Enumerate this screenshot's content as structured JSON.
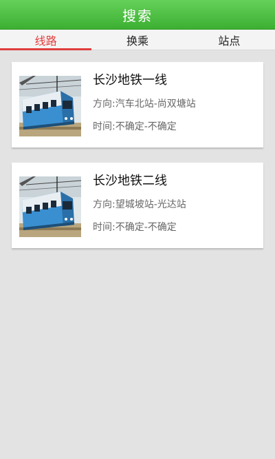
{
  "header": {
    "title": "搜索"
  },
  "tabs": [
    {
      "label": "线路",
      "active": true
    },
    {
      "label": "换乘",
      "active": false
    },
    {
      "label": "站点",
      "active": false
    }
  ],
  "lines": [
    {
      "name": "长沙地铁一线",
      "direction": "方向:汽车北站-尚双塘站",
      "time": "时间:不确定-不确定",
      "icon": "metro-train-icon"
    },
    {
      "name": "长沙地铁二线",
      "direction": "方向:望城坡站-光达站",
      "time": "时间:不确定-不确定",
      "icon": "metro-train-icon"
    }
  ],
  "colors": {
    "header_green": "#4cc043",
    "tab_active": "#e13d3d",
    "background": "#e3e3e3"
  }
}
